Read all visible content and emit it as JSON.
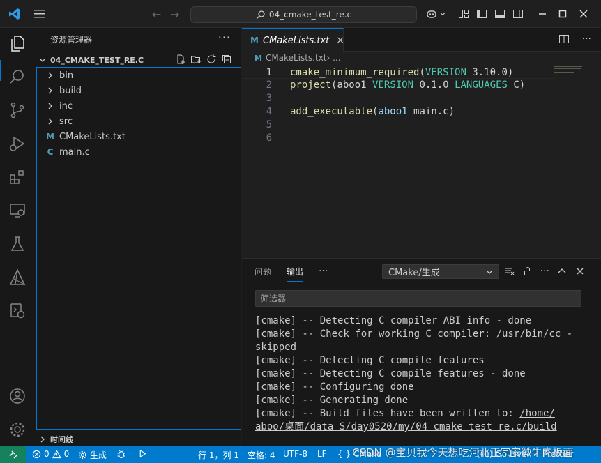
{
  "titlebar": {
    "search_text": "04_cmake_test_re.c",
    "icons": [
      "vscode-logo-icon",
      "menu-icon",
      "back-arrow-icon",
      "forward-arrow-icon",
      "search-icon",
      "copilot-icon",
      "chevron-down-icon",
      "layout-customize-icon",
      "toggle-sidebar-icon",
      "toggle-panel-icon",
      "toggle-secondary-sidebar-icon",
      "minimize-icon",
      "maximize-icon",
      "close-icon"
    ]
  },
  "activity_bar": [
    "explorer-icon",
    "search-icon",
    "source-control-icon",
    "run-debug-icon",
    "extensions-icon",
    "remote-explorer-icon",
    "testing-icon",
    "cmake-icon",
    "docker-icon",
    "account-icon",
    "settings-gear-icon"
  ],
  "sidebar": {
    "title": "资源管理器",
    "more": "···",
    "folder": "04_CMAKE_TEST_RE.C",
    "items": [
      {
        "label": "bin",
        "kind": "folder"
      },
      {
        "label": "build",
        "kind": "folder"
      },
      {
        "label": "inc",
        "kind": "folder"
      },
      {
        "label": "src",
        "kind": "folder"
      },
      {
        "label": "CMakeLists.txt",
        "kind": "cmake",
        "icon": "M"
      },
      {
        "label": "main.c",
        "kind": "c",
        "icon": "C"
      }
    ],
    "timeline": "时间线"
  },
  "editor": {
    "tab_label": "CMakeLists.txt",
    "tab_icon": "M",
    "tab_close": "×",
    "breadcrumb_file": "CMakeLists.txt",
    "breadcrumb_rest": " › ...",
    "lines": [
      {
        "n": "1",
        "tokens": [
          [
            "fn",
            "cmake_minimum_required"
          ],
          [
            "plain",
            "("
          ],
          [
            "kw",
            "VERSION"
          ],
          [
            "plain",
            " 3.10.0)"
          ]
        ]
      },
      {
        "n": "2",
        "tokens": [
          [
            "fn",
            "project"
          ],
          [
            "plain",
            "(aboo1 "
          ],
          [
            "kw",
            "VERSION"
          ],
          [
            "plain",
            " 0.1.0 "
          ],
          [
            "kw",
            "LANGUAGES"
          ],
          [
            "plain",
            " C)"
          ]
        ]
      },
      {
        "n": "3",
        "tokens": []
      },
      {
        "n": "4",
        "tokens": [
          [
            "fn",
            "add_executable"
          ],
          [
            "plain",
            "("
          ],
          [
            "var",
            "aboo1"
          ],
          [
            "plain",
            " main.c)"
          ]
        ]
      },
      {
        "n": "5",
        "tokens": []
      },
      {
        "n": "6",
        "tokens": []
      }
    ]
  },
  "panel": {
    "tabs": [
      "问题",
      "输出"
    ],
    "more": "···",
    "channel": "CMake/生成",
    "filter_placeholder": "筛选器",
    "output": [
      "[cmake] -- Detecting C compiler ABI info - done",
      "[cmake] -- Check for working C compiler: /usr/bin/cc -",
      "skipped",
      "[cmake] -- Detecting C compile features",
      "[cmake] -- Detecting C compile features - done",
      "[cmake] -- Configuring done",
      "[cmake] -- Generating done"
    ],
    "output_written_prefix": "[cmake] -- Build files have been written to: ",
    "output_written_path1": "/home/",
    "output_written_path2": "aboo/桌面/data_S/day0520/my/04_cmake_test_re.c/build"
  },
  "statusbar": {
    "problems": "0",
    "warnings": "0",
    "build": "生成",
    "position": "行 1，列 1",
    "spaces": "空格: 4",
    "encoding": "UTF-8",
    "eol": "LF",
    "language": "CMake",
    "go_live": "Go Live",
    "prettier": "Prettier"
  },
  "watermark": "CSDN @宝贝我今天想吃河北正宗安徽牛肉板面",
  "colors": {
    "accent": "#0078d4",
    "status": "#007acc",
    "remote": "#16825d"
  }
}
